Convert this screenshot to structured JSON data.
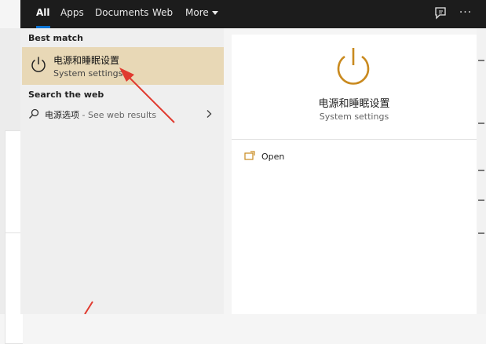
{
  "tabs": [
    {
      "label": "All",
      "active": true
    },
    {
      "label": "Apps",
      "active": false
    },
    {
      "label": "Documents",
      "active": false
    },
    {
      "label": "Web",
      "active": false
    },
    {
      "label": "More",
      "active": false
    }
  ],
  "toolbar": {
    "feedback_icon": "feedback-icon",
    "more_icon": "more-options-icon",
    "more_glyph": "···"
  },
  "best_match": {
    "heading": "Best match",
    "title": "电源和睡眠设置",
    "subtitle": "System settings",
    "icon": "power-icon"
  },
  "search_web": {
    "heading": "Search the web",
    "query": "电源选项",
    "suffix": " - See web results",
    "icon": "search-icon"
  },
  "preview": {
    "title": "电源和睡眠设置",
    "subtitle": "System settings",
    "icon": "power-icon",
    "actions": [
      {
        "label": "Open",
        "icon": "open-icon"
      }
    ]
  },
  "colors": {
    "accent": "#0a74d4",
    "highlight": "#e8d8b6",
    "power_icon": "#c98a1f",
    "annotation_arrow": "#e03a2f"
  }
}
